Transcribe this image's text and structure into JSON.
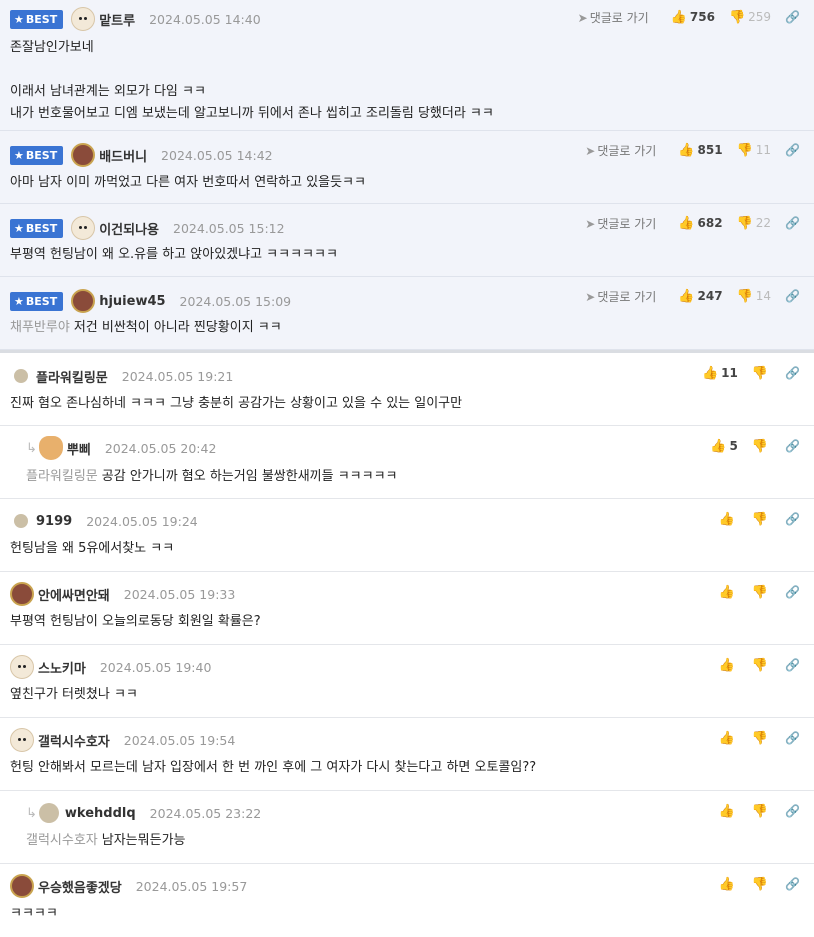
{
  "best_comments": [
    {
      "badge": "BEST",
      "nick": "맡트루",
      "date": "2024.05.05 14:40",
      "goto": "댓글로 가기",
      "up": "756",
      "down": "259",
      "lines": [
        "존잘남인가보네",
        "",
        "이래서 남녀관계는 외모가 다임 ㅋㅋ",
        "내가 번호물어보고 디엠 보냈는데 알고보니까 뒤에서 존나 씹히고 조리돌림 당했더라 ㅋㅋ"
      ]
    },
    {
      "badge": "BEST",
      "nick": "배드버니",
      "date": "2024.05.05 14:42",
      "goto": "댓글로 가기",
      "up": "851",
      "down": "11",
      "lines": [
        "아마 남자 이미 까먹었고 다른 여자 번호따서 연락하고 있을듯ㅋㅋ"
      ]
    },
    {
      "badge": "BEST",
      "nick": "이건되나용",
      "date": "2024.05.05 15:12",
      "goto": "댓글로 가기",
      "up": "682",
      "down": "22",
      "lines": [
        "부평역 헌팅남이 왜 오.유를 하고 앉아있겠냐고 ㅋㅋㅋㅋㅋㅋ"
      ]
    },
    {
      "badge": "BEST",
      "nick": "hjuiew45",
      "date": "2024.05.05 15:09",
      "goto": "댓글로 가기",
      "up": "247",
      "down": "14",
      "quote": "채푸반루야",
      "text": "저건 비싼척이 아니라 찐당황이지 ㅋㅋ"
    }
  ],
  "comments": [
    {
      "nick": "플라워킬링문",
      "date": "2024.05.05 19:21",
      "up": "11",
      "text": "진짜 혐오 존나심하네 ㅋㅋㅋ 그냥 충분히 공감가는 상황이고 있을 수 있는 일이구만"
    },
    {
      "nick": "뿌삐",
      "date": "2024.05.05 20:42",
      "up": "5",
      "quote": "플라워킬링문",
      "text": "공감 안가니까 혐오 하는거임 불쌍한새끼들 ㅋㅋㅋㅋㅋ"
    },
    {
      "nick": "9199",
      "date": "2024.05.05 19:24",
      "up": "",
      "text": "헌팅남을 왜 5유에서찾노 ㅋㅋ"
    },
    {
      "nick": "안에싸면안돼",
      "date": "2024.05.05 19:33",
      "up": "",
      "text": "부평역 헌팅남이 오늘의로동당 회원일 확률은?"
    },
    {
      "nick": "스노키마",
      "date": "2024.05.05 19:40",
      "up": "",
      "text": "옆친구가 터렛쳤나 ㅋㅋ"
    },
    {
      "nick": "갤럭시수호자",
      "date": "2024.05.05 19:54",
      "up": "",
      "text": "헌팅 안해봐서 모르는데 남자 입장에서 한 번 까인 후에 그 여자가 다시 찾는다고 하면 오토콜임??"
    },
    {
      "nick": "wkehddlq",
      "date": "2024.05.05 23:22",
      "up": "",
      "quote": "갤럭시수호자",
      "text": "남자는뭐든가능"
    },
    {
      "nick": "우승했음좋겠당",
      "date": "2024.05.05 19:57",
      "up": "",
      "text": "ㅋㅋㅋㅋ"
    }
  ],
  "icons": {
    "thumb_up": "thumb-up-icon",
    "thumb_down": "thumb-down-icon",
    "link": "link-icon",
    "paper_plane": "paper-plane-icon",
    "star": "star-icon",
    "reply_arrow": "reply-arrow-icon"
  },
  "colors": {
    "best_badge": "#3a74d3",
    "best_background": "#f2f4fa"
  }
}
